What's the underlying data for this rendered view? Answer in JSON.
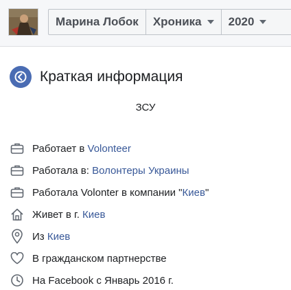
{
  "header": {
    "name": "Марина Лобок",
    "section": "Хроника",
    "year": "2020"
  },
  "intro": {
    "title": "Краткая информация",
    "bio": "ЗСУ",
    "items": [
      {
        "icon": "briefcase-icon",
        "prefix": "Работает в ",
        "link": "Volonteer",
        "suffix": ""
      },
      {
        "icon": "briefcase-icon",
        "prefix": "Работала в: ",
        "link": "Волонтеры Украины",
        "suffix": ""
      },
      {
        "icon": "briefcase-icon",
        "prefix": "Работала Volonter в компании \"",
        "link": "Киев",
        "suffix": "\""
      },
      {
        "icon": "home-icon",
        "prefix": "Живет в г. ",
        "link": "Киев",
        "suffix": ""
      },
      {
        "icon": "location-pin-icon",
        "prefix": "Из ",
        "link": "Киев",
        "suffix": ""
      },
      {
        "icon": "heart-icon",
        "prefix": "В гражданском партнерстве",
        "link": "",
        "suffix": ""
      },
      {
        "icon": "clock-icon",
        "prefix": "На Facebook с Январь 2016 г.",
        "link": "",
        "suffix": ""
      }
    ]
  },
  "colors": {
    "link": "#385898",
    "accent": "#4a6cb3"
  }
}
